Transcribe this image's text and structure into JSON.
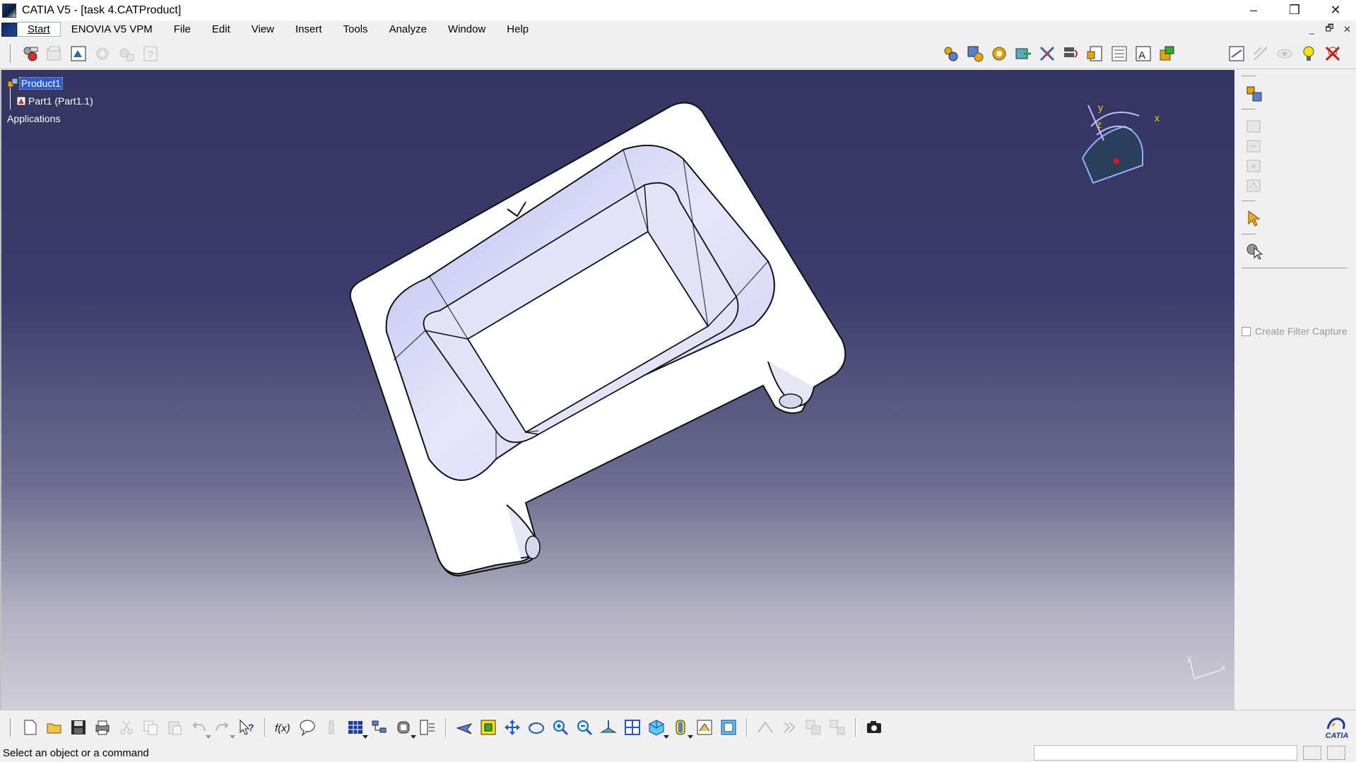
{
  "window": {
    "title": "CATIA V5 - [task 4.CATProduct]",
    "controls": [
      "–",
      "❐",
      "✕"
    ],
    "mdi_controls": [
      "_",
      "🗗",
      "✕"
    ]
  },
  "menu": {
    "items": [
      "Start",
      "ENOVIA V5 VPM",
      "File",
      "Edit",
      "View",
      "Insert",
      "Tools",
      "Analyze",
      "Window",
      "Help"
    ]
  },
  "tree": {
    "root": "Product1",
    "child": "Part1 (Part1.1)",
    "applications": "Applications"
  },
  "compass": {
    "x_label": "x",
    "y_label": "y",
    "z_label": "z"
  },
  "axis_triad": {
    "x_label": "x",
    "y_label": "y"
  },
  "right_panel": {
    "filter_capture_label": "Create Filter Capture"
  },
  "status": {
    "message": "Select an object or a command",
    "command_input": ""
  },
  "brand": {
    "catia_label": "CATIA"
  },
  "colors": {
    "viewport_top": "#353563",
    "viewport_bottom": "#cfcdd6",
    "selection": "#2a5ad8",
    "part_edge": "#111111",
    "part_face": "#ffffff",
    "part_shade": "#c8c8f4"
  }
}
